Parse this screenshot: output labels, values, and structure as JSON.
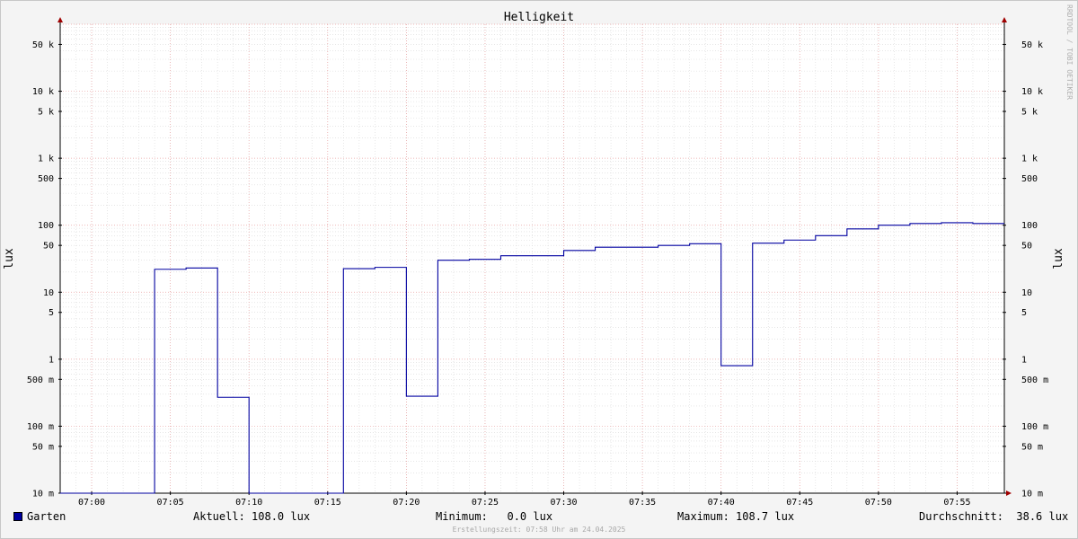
{
  "chart_data": {
    "type": "line",
    "title": "Helligkeit",
    "ylabel": "lux",
    "yscale": "log",
    "ylim": [
      0.01,
      100000
    ],
    "grid": true,
    "x_range": [
      "06:58",
      "07:58"
    ],
    "x_ticks": [
      "07:00",
      "07:05",
      "07:10",
      "07:15",
      "07:20",
      "07:25",
      "07:30",
      "07:35",
      "07:40",
      "07:45",
      "07:50",
      "07:55"
    ],
    "y_ticks": [
      {
        "value": 50000,
        "label": "50 k"
      },
      {
        "value": 10000,
        "label": "10 k"
      },
      {
        "value": 5000,
        "label": "5 k"
      },
      {
        "value": 1000,
        "label": "1 k"
      },
      {
        "value": 500,
        "label": "500"
      },
      {
        "value": 100,
        "label": "100"
      },
      {
        "value": 50,
        "label": "50"
      },
      {
        "value": 10,
        "label": "10"
      },
      {
        "value": 5,
        "label": "5"
      },
      {
        "value": 1,
        "label": "1"
      },
      {
        "value": 0.5,
        "label": "500 m"
      },
      {
        "value": 0.1,
        "label": "100 m"
      },
      {
        "value": 0.05,
        "label": "50 m"
      },
      {
        "value": 0.01,
        "label": "10 m"
      }
    ],
    "series": [
      {
        "name": "Garten",
        "color": "#0000a0",
        "step": true,
        "points": [
          {
            "x": "06:58",
            "y": 0
          },
          {
            "x": "07:04",
            "y": 22
          },
          {
            "x": "07:06",
            "y": 23
          },
          {
            "x": "07:08",
            "y": 0.27
          },
          {
            "x": "07:10",
            "y": 0
          },
          {
            "x": "07:16",
            "y": 22.5
          },
          {
            "x": "07:18",
            "y": 23.5
          },
          {
            "x": "07:20",
            "y": 0.28
          },
          {
            "x": "07:22",
            "y": 30
          },
          {
            "x": "07:24",
            "y": 31
          },
          {
            "x": "07:26",
            "y": 35
          },
          {
            "x": "07:28",
            "y": 35
          },
          {
            "x": "07:30",
            "y": 42
          },
          {
            "x": "07:32",
            "y": 47
          },
          {
            "x": "07:34",
            "y": 47
          },
          {
            "x": "07:36",
            "y": 50
          },
          {
            "x": "07:38",
            "y": 53
          },
          {
            "x": "07:40",
            "y": 0.8
          },
          {
            "x": "07:42",
            "y": 54
          },
          {
            "x": "07:44",
            "y": 60
          },
          {
            "x": "07:46",
            "y": 70
          },
          {
            "x": "07:48",
            "y": 88
          },
          {
            "x": "07:50",
            "y": 100
          },
          {
            "x": "07:52",
            "y": 106
          },
          {
            "x": "07:54",
            "y": 109
          },
          {
            "x": "07:56",
            "y": 106
          },
          {
            "x": "07:58",
            "y": 106
          }
        ]
      }
    ]
  },
  "watermark": "RRDTOOL / TOBI OETIKER",
  "legend": {
    "series_name": "Garten",
    "current": "Aktuell: 108.0 lux",
    "minimum": "Minimum:   0.0 lux",
    "maximum": "Maximum: 108.7 lux",
    "average": "Durchschnitt:  38.6 lux"
  },
  "footer": "Erstellungszeit: 07:58 Uhr am 24.04.2025"
}
